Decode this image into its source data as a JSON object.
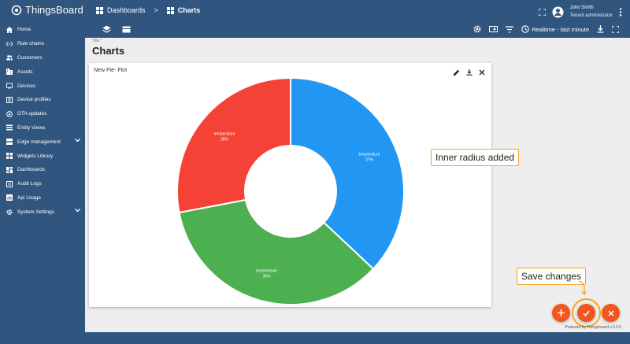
{
  "app": {
    "name": "ThingsBoard"
  },
  "header": {
    "breadcrumb": [
      "Dashboards",
      "Charts"
    ],
    "breadcrumb_sep": ">",
    "user_name": "John Smith",
    "user_role": "Tenant administrator"
  },
  "sidebar": {
    "items": [
      {
        "label": "Home",
        "icon": "home-icon"
      },
      {
        "label": "Rule chains",
        "icon": "code-icon"
      },
      {
        "label": "Customers",
        "icon": "people-icon"
      },
      {
        "label": "Assets",
        "icon": "building-icon"
      },
      {
        "label": "Devices",
        "icon": "device-icon"
      },
      {
        "label": "Device profiles",
        "icon": "profile-icon"
      },
      {
        "label": "OTA updates",
        "icon": "ota-icon"
      },
      {
        "label": "Entity Views",
        "icon": "view-icon"
      },
      {
        "label": "Edge management",
        "icon": "edge-icon"
      },
      {
        "label": "Widgets Library",
        "icon": "widgets-icon"
      },
      {
        "label": "Dashboards",
        "icon": "dashboard-icon"
      },
      {
        "label": "Audit Logs",
        "icon": "audit-icon"
      },
      {
        "label": "Api Usage",
        "icon": "api-icon"
      },
      {
        "label": "System Settings",
        "icon": "settings-icon"
      }
    ]
  },
  "toolbar": {
    "timewindow": "Realtime - last minute"
  },
  "page": {
    "title_label": "Title *",
    "title": "Charts"
  },
  "widget": {
    "title": "New Pie- Flot",
    "chart_data": {
      "type": "pie",
      "inner_radius": true,
      "slices": [
        {
          "label": "temperature",
          "percent_label": "37%",
          "value": 37,
          "color": "#2196f3"
        },
        {
          "label": "temperature",
          "percent_label": "35%",
          "value": 35,
          "color": "#4caf50"
        },
        {
          "label": "temperature",
          "percent_label": "28%",
          "value": 28,
          "color": "#f44336"
        }
      ]
    }
  },
  "callouts": {
    "radius": "Inner radius added",
    "save": "Save changes"
  },
  "footer": {
    "powered_by": "Powered by Thingsboard",
    "version": "v.3.3.0"
  },
  "colors": {
    "primary": "#305680",
    "accent": "#f2561d",
    "highlight": "#f5a623"
  }
}
